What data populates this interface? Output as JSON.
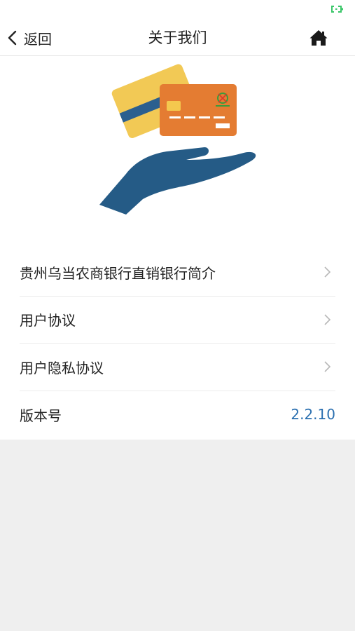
{
  "navbar": {
    "back_label": "返回",
    "title": "关于我们",
    "back_icon": "chevron-left-icon",
    "home_icon": "home-icon"
  },
  "hero": {
    "icon": "hand-holding-cards-illustration"
  },
  "menu": {
    "items": [
      {
        "label": "贵州乌当农商银行直销银行简介",
        "icon": "chevron-right-icon"
      },
      {
        "label": "用户协议",
        "icon": "chevron-right-icon"
      },
      {
        "label": "用户隐私协议",
        "icon": "chevron-right-icon"
      }
    ],
    "version": {
      "label": "版本号",
      "value": "2.2.10"
    }
  },
  "colors": {
    "accent": "#2a6fb0",
    "status_green": "#3cc76a",
    "hand": "#255b86",
    "card_yellow": "#f2c955",
    "card_orange": "#e47c32"
  }
}
